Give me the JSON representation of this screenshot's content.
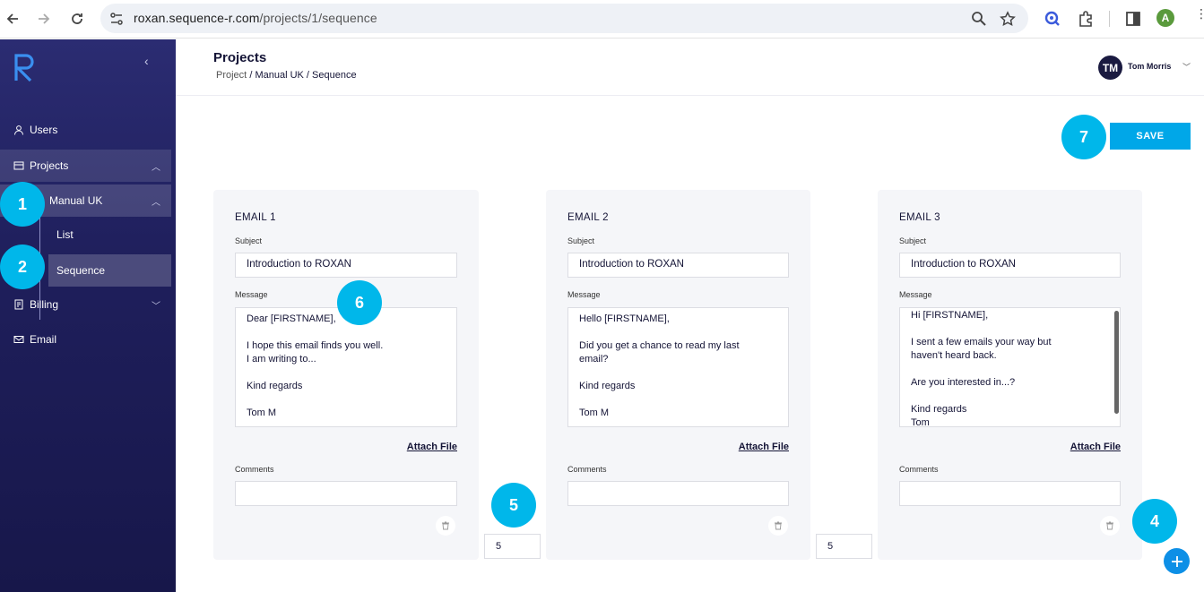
{
  "browser": {
    "url_host": "roxan.sequence-r.com",
    "url_path": "/projects/1/sequence",
    "profile_initial": "A"
  },
  "sidebar": {
    "items": [
      {
        "label": "Users",
        "icon": "user-icon"
      },
      {
        "label": "Projects",
        "icon": "projects-icon"
      },
      {
        "label": "Manual UK"
      },
      {
        "label": "List"
      },
      {
        "label": "Sequence"
      },
      {
        "label": "Billing",
        "icon": "billing-icon"
      },
      {
        "label": "Email",
        "icon": "email-icon"
      }
    ]
  },
  "header": {
    "title": "Projects",
    "breadcrumb": [
      "Project",
      "Manual UK",
      "Sequence"
    ],
    "separator": "/",
    "user": {
      "initials": "TM",
      "name": "Tom Morris"
    }
  },
  "actions": {
    "save_label": "SAVE"
  },
  "labels": {
    "subject": "Subject",
    "message": "Message",
    "comments": "Comments",
    "attach": "Attach File"
  },
  "emails": [
    {
      "title": "EMAIL 1",
      "subject": "Introduction to ROXAN",
      "message": "Dear [FIRSTNAME],\n\nI hope this email finds you well.\nI am writing to...\n\nKind regards\n\nTom M",
      "comments": ""
    },
    {
      "title": "EMAIL 2",
      "subject": "Introduction to ROXAN",
      "message": "Hello [FIRSTNAME],\n\nDid you get a chance to read my last\nemail?\n\nKind regards\n\nTom M",
      "comments": ""
    },
    {
      "title": "EMAIL 3",
      "subject": "Introduction to ROXAN",
      "message": "Hi [FIRSTNAME],\n\nI sent a few emails your way but\nhaven't heard back.\n\nAre you interested in...?\n\nKind regards\nTom",
      "comments": ""
    }
  ],
  "delays": [
    "5",
    "5"
  ],
  "annotations": [
    "1",
    "2",
    "4",
    "5",
    "6",
    "7"
  ],
  "colors": {
    "accent": "#00a7e8",
    "sidebar": "#1f1f5c",
    "marker": "#00b7ea"
  }
}
